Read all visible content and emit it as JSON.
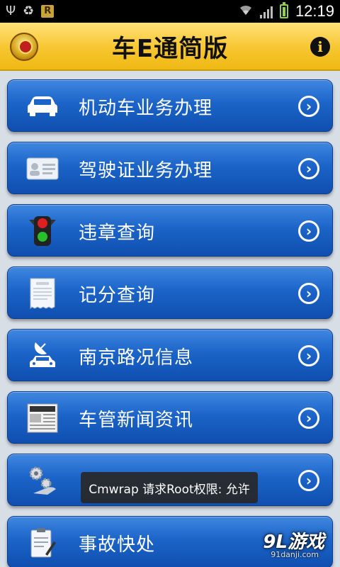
{
  "status_bar": {
    "time": "12:19",
    "left_icons": [
      "usb-icon",
      "recycle-icon",
      "r-app-icon"
    ],
    "right_icons": [
      "wifi-icon",
      "signal-icon",
      "battery-icon"
    ]
  },
  "header": {
    "title": "车E通简版",
    "left_icon": "police-emblem-icon",
    "right_icon": "info-icon",
    "background": "#f7c62f"
  },
  "menu": {
    "accent": "#1c64c8",
    "items": [
      {
        "label": "机动车业务办理",
        "icon": "car-icon"
      },
      {
        "label": "驾驶证业务办理",
        "icon": "license-card-icon"
      },
      {
        "label": "违章查询",
        "icon": "traffic-light-icon"
      },
      {
        "label": "记分查询",
        "icon": "ticket-icon"
      },
      {
        "label": "南京路况信息",
        "icon": "satellite-car-icon"
      },
      {
        "label": "车管新闻资讯",
        "icon": "newspaper-icon"
      },
      {
        "label": "",
        "icon": "gears-hand-icon"
      },
      {
        "label": "事故快处",
        "icon": "clipboard-pen-icon"
      }
    ]
  },
  "toast": {
    "text": "Cmwrap 请求Root权限: 允许"
  },
  "watermark": {
    "logo": "9L游戏",
    "url": "91danji.com"
  }
}
